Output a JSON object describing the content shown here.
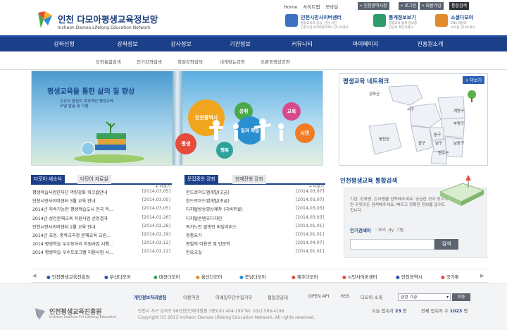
{
  "header": {
    "site_title": "인천 다모아평생교육정보망",
    "site_title_en": "Incheon Damoa Lifelong Education Network",
    "top_links": [
      "Home",
      "사이트맵",
      "모바일"
    ],
    "top_buttons": [
      "인천광역시청",
      "로그인",
      "회원가입",
      "통합검색"
    ],
    "services": [
      {
        "title": "인천시민사이버센터",
        "desc": "평생교육의 중심, 인천 시민\n인천시민사이버센터에서 만나보세요"
      },
      {
        "title": "통계정보보기",
        "desc": "평생교육 통계 정보를\n한눈에 확인하세요"
      },
      {
        "title": "소셜다모아",
        "desc": "SNS 채널로\n소식을 만나보세요"
      }
    ]
  },
  "gnb": {
    "items": [
      "강좌신청",
      "강좌정보",
      "강사정보",
      "기관정보",
      "커뮤니티",
      "마이페이지",
      "진흥원소개"
    ]
  },
  "subnav": {
    "items": [
      "강좌통합검색",
      "인기강좌검색",
      "회원강좌검색",
      "내게맞는강좌",
      "오픈동영상강좌"
    ]
  },
  "banner": {
    "slogan": "평생교육을 통한 삶의 질 향상",
    "sub": "수요자 중심의 효과적인 평생교육\n모델 발굴 및 지원",
    "circles": [
      "인천광역시",
      "성취",
      "교육",
      "일과 학습",
      "시민",
      "평생",
      "행복"
    ]
  },
  "network": {
    "title": "평생교육 네트워크",
    "more": "+ 더보기",
    "districts": [
      "강화군",
      "서구",
      "계양구",
      "부평구",
      "옹진군",
      "동구",
      "중구",
      "남구",
      "남동구",
      "연수구"
    ]
  },
  "integrated_search": {
    "title": "인천평생교육 통합검색",
    "desc": "기관, 강좌명, 강사명을 입력해주세요. 궁금한 것이 있으시면 무엇이든 검색해주세요. 빠르고 정확한 정보를 알려드립니다.",
    "keyword_label": "인기검색어",
    "keywords": ": 요리 .dy. 그림",
    "input_placeholder": "",
    "button": "검색"
  },
  "board_news": {
    "tab_on": "다모아 새소식",
    "tab_off": "다모아 자료실",
    "more": "+ 더보기",
    "rows": [
      {
        "title": "평생학습사업인자단 역량강화 워크숍안내",
        "date": "[2014,03,05]"
      },
      {
        "title": "인천시민사이버센터 3월 교육 안내",
        "date": "[2014,03,05]"
      },
      {
        "title": "2014년 지속가능한 평생학습도시 전국 학...",
        "date": "[2014,03,05]"
      },
      {
        "title": "2014년 성인문해교육 지원사업 선정결과",
        "date": "[2014,02,26]"
      },
      {
        "title": "인천시민사이버센터 2월 교육 안내",
        "date": "[2014,02,26]"
      },
      {
        "title": "2014년 초등. 중학교과정 문해교육 교원...",
        "date": "[2014,02,19]"
      },
      {
        "title": "2014 평생학습 우수동아리 지원사업 시행...",
        "date": "[2014,02,12]"
      },
      {
        "title": "2014 평생학습 우수프로그램 지원사업 시...",
        "date": "[2014,02,12]"
      }
    ]
  },
  "board_courses": {
    "tab_on": "모집중인 강좌",
    "tab_off": "현재진행 강좌",
    "more": "+ 더보기",
    "rows": [
      {
        "title": "한드로이드앱개발(고급)",
        "date": "[2014,03,07]"
      },
      {
        "title": "한드로이드앱개발(초급)",
        "date": "[2014,03,07]"
      },
      {
        "title": "디지털방송영상제작 (국비무료)",
        "date": "[2014,03,03]"
      },
      {
        "title": "디지털콘텐츠디자인",
        "date": "[2014,03,03]"
      },
      {
        "title": "독거노인 말벗만 바달서비스",
        "date": "[2014,01,01]"
      },
      {
        "title": "정통요가",
        "date": "[2014,01,01]"
      },
      {
        "title": "봉발의 이용관 및 인문학",
        "date": "[2014,04,07]"
      },
      {
        "title": "한요교실",
        "date": "[2014,01,01]"
      }
    ]
  },
  "family_sites": [
    "인천평생교육진흥원",
    "부산다모아",
    "대전다모아",
    "울산다모아",
    "충남다모아",
    "제주다모아",
    "시민사이버센터",
    "인천광역시",
    "국가투"
  ],
  "footer": {
    "links": [
      "개인정보처리방침",
      "이용약관",
      "이메일무단수집거부",
      "협업관공대",
      "OPEN API",
      "RSS",
      "다모아 소개"
    ],
    "select_label": "관련 기관",
    "go_button": "이동",
    "org_name": "인천평생교육진흥원",
    "org_name_en": "Incheon Institute For Lifelong Education",
    "address": "인천시 서구 심곡로 98(인천인재개발원 3층)(우) 404-190 Tel. 032) 586-4196",
    "copyright": "Copyright (C) 2013 Incheon Damoa Lifelong Education Network. All rights reserved.",
    "today_label": "오늘 접속자",
    "today_value": "23",
    "total_label": "전체 접속자 수",
    "total_value": "1023",
    "unit": "명"
  },
  "colors": {
    "primary": "#1c3f8a",
    "accent": "#2c5fb4"
  }
}
